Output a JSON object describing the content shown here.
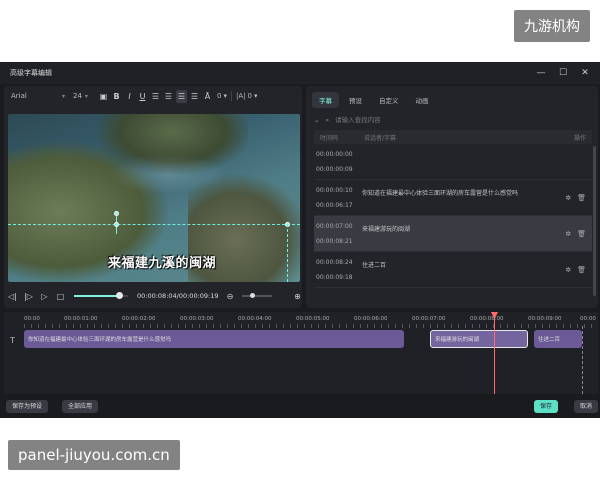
{
  "watermark": {
    "top": "九游机构",
    "bottom": "panel-jiuyou.com.cn"
  },
  "window": {
    "title": "高级字幕编辑",
    "min": "—",
    "max": "☐",
    "close": "✕"
  },
  "toolbar": {
    "font": "Arial",
    "size": "24",
    "bold": "B",
    "italic": "I",
    "underline": "U",
    "spacing": "0",
    "line_height_icon": "|A|",
    "line_height": "0"
  },
  "video": {
    "subtitle_text": "来福建九溪的闽湖"
  },
  "player": {
    "timecode": "00:00:08:04/00:00:09:19",
    "progress": 0.83
  },
  "right": {
    "tabs": [
      "字幕",
      "预设",
      "自定义",
      "动画"
    ],
    "search_placeholder": "请输入查找内容",
    "col_time": "时间码",
    "col_text": "说话者/字幕",
    "col_op": "操作",
    "rows": [
      {
        "start": "00:00:00:00",
        "end": "00:00:00:09",
        "text": ""
      },
      {
        "start": "00:00:00:10",
        "end": "00:00:06:17",
        "text": "你知道在福建最中心体验三面环湖的房车露营是什么感觉吗"
      },
      {
        "start": "00:00:07:00",
        "end": "00:00:08:21",
        "text": "来福建游玩的闽湖"
      },
      {
        "start": "00:00:08:24",
        "end": "00:00:09:18",
        "text": "住进二百"
      }
    ]
  },
  "timeline": {
    "ticks": [
      "00:00",
      "00:00:01:00",
      "00:00:02:00",
      "00:00:03:00",
      "00:00:04:00",
      "00:00:05:00",
      "00:00:06:00",
      "00:00:07:00",
      "00:00:08:00",
      "00:00:09:00",
      "00:00"
    ],
    "clips": [
      "你知道在福建最中心体验三面环湖的房车露营是什么感觉吗",
      "来福建游玩的闽湖",
      "住进二百"
    ]
  },
  "footer": {
    "save_preset": "保存为预设",
    "apply_all": "全部应用",
    "save": "保存",
    "cancel": "取消"
  }
}
